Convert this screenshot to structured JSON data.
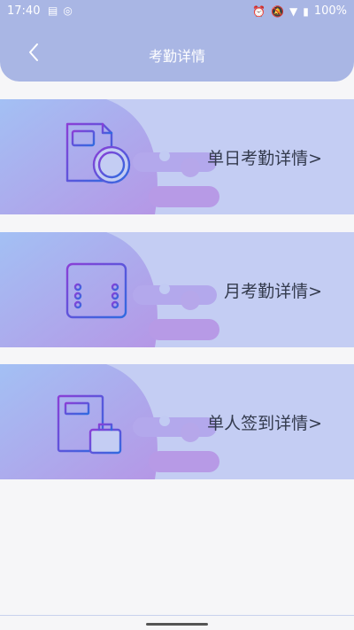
{
  "status_bar": {
    "time": "17:40",
    "battery": "100%",
    "left_icons": [
      "message-icon",
      "sync-icon"
    ],
    "right_icons": [
      "alarm-icon",
      "mute-icon",
      "wifi-icon",
      "battery-icon"
    ]
  },
  "header": {
    "title": "考勤详情",
    "back_icon": "chevron-left-icon"
  },
  "cards": [
    {
      "label": "单日考勤详情>",
      "icon": "document-clock-icon"
    },
    {
      "label": "月考勤详情>",
      "icon": "calendar-list-icon"
    },
    {
      "label": "单人签到详情>",
      "icon": "document-briefcase-icon"
    }
  ],
  "colors": {
    "header_bg": "#a9b6e4",
    "card_bg": "#c4cdf3",
    "blob_light": "#a6bdf3",
    "blob_purple": "#b79ae6",
    "icon_gradient_start": "#8b3fd6",
    "icon_gradient_end": "#2f6be0"
  }
}
